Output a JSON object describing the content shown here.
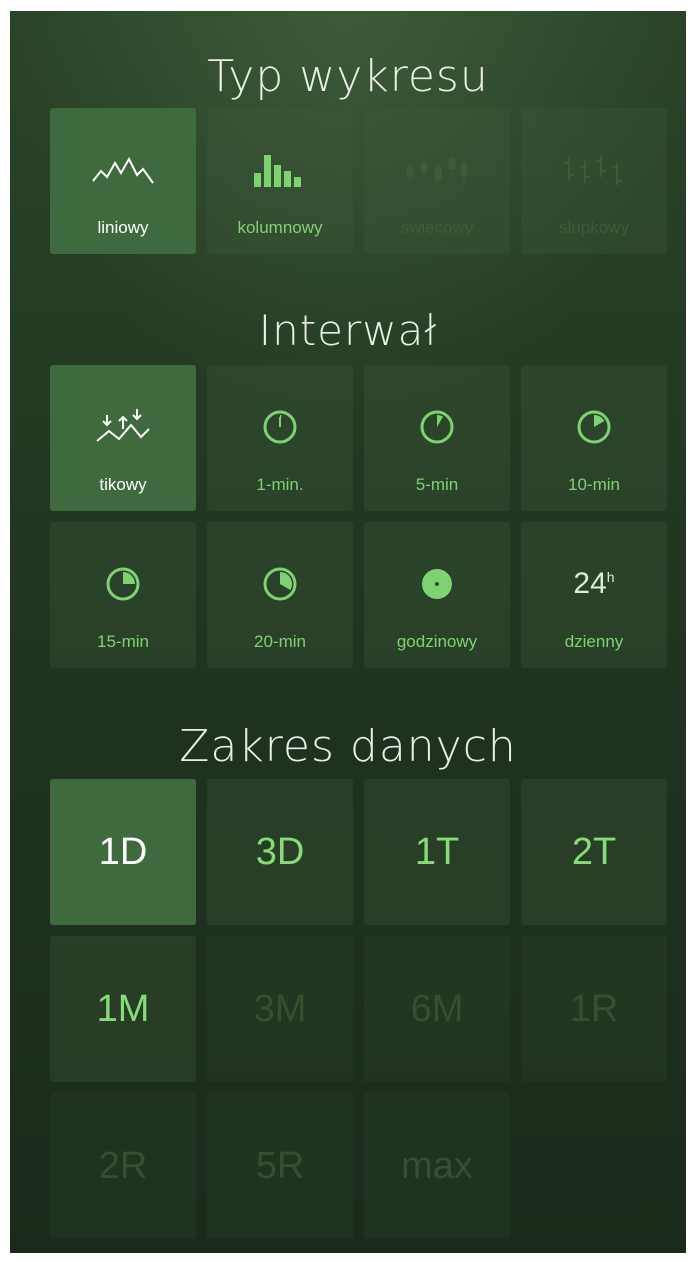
{
  "chart_type_section": {
    "title": "Typ wykresu",
    "items": [
      {
        "label": "liniowy",
        "icon": "line-chart-icon",
        "state": "selected"
      },
      {
        "label": "kolumnowy",
        "icon": "bar-chart-icon",
        "state": "enabled"
      },
      {
        "label": "swiecowy",
        "icon": "candlestick-chart-icon",
        "state": "disabled"
      },
      {
        "label": "słupkowy",
        "icon": "ohlc-chart-icon",
        "state": "disabled"
      }
    ]
  },
  "interval_section": {
    "title": "Interwał",
    "items": [
      {
        "label": "tikowy",
        "icon": "tick-chart-icon",
        "state": "selected"
      },
      {
        "label": "1-min.",
        "icon": "clock-1min-icon",
        "state": "enabled"
      },
      {
        "label": "5-min",
        "icon": "clock-5min-icon",
        "state": "enabled"
      },
      {
        "label": "10-min",
        "icon": "clock-10min-icon",
        "state": "enabled"
      },
      {
        "label": "15-min",
        "icon": "clock-15min-icon",
        "state": "enabled"
      },
      {
        "label": "20-min",
        "icon": "clock-20min-icon",
        "state": "enabled"
      },
      {
        "label": "godzinowy",
        "icon": "clock-hour-icon",
        "state": "enabled"
      },
      {
        "label": "dzienny",
        "icon": "24h-icon",
        "icon_text": "24",
        "icon_sup": "h",
        "state": "enabled"
      }
    ]
  },
  "range_section": {
    "title": "Zakres danych",
    "items": [
      {
        "label": "1D",
        "state": "selected"
      },
      {
        "label": "3D",
        "state": "enabled"
      },
      {
        "label": "1T",
        "state": "enabled"
      },
      {
        "label": "2T",
        "state": "enabled"
      },
      {
        "label": "1M",
        "state": "enabled"
      },
      {
        "label": "3M",
        "state": "disabled"
      },
      {
        "label": "6M",
        "state": "disabled"
      },
      {
        "label": "1R",
        "state": "disabled"
      },
      {
        "label": "2R",
        "state": "disabled"
      },
      {
        "label": "5R",
        "state": "disabled"
      },
      {
        "label": "max",
        "state": "disabled"
      }
    ]
  },
  "colors": {
    "accent_green": "#86dd78",
    "selected_tile": "#3f6a3d",
    "disabled_text": "#34502f"
  }
}
